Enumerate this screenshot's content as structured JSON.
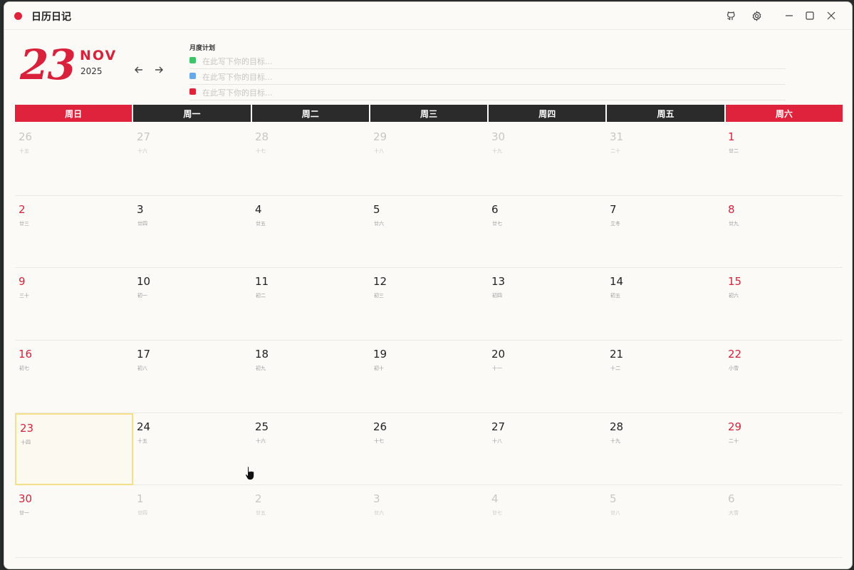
{
  "app": {
    "title": "日历日记"
  },
  "header": {
    "day": "23",
    "month": "NOV",
    "year": "2025",
    "plan_label": "月度计划",
    "goals": [
      {
        "color": "#3fc46a",
        "placeholder": "在此写下你的目标..."
      },
      {
        "color": "#6aa9e9",
        "placeholder": "在此写下你的目标..."
      },
      {
        "color": "#e0233c",
        "placeholder": "在此写下你的目标..."
      }
    ]
  },
  "weekdays": [
    "周日",
    "周一",
    "周二",
    "周三",
    "周四",
    "周五",
    "周六"
  ],
  "weeks": [
    [
      {
        "day": "26",
        "lunar": "十五",
        "other": true
      },
      {
        "day": "27",
        "lunar": "十六",
        "other": true
      },
      {
        "day": "28",
        "lunar": "十七",
        "other": true
      },
      {
        "day": "29",
        "lunar": "十八",
        "other": true
      },
      {
        "day": "30",
        "lunar": "十九",
        "other": true
      },
      {
        "day": "31",
        "lunar": "二十",
        "other": true
      },
      {
        "day": "1",
        "lunar": "廿二",
        "other": false
      }
    ],
    [
      {
        "day": "2",
        "lunar": "廿三"
      },
      {
        "day": "3",
        "lunar": "廿四"
      },
      {
        "day": "4",
        "lunar": "廿五"
      },
      {
        "day": "5",
        "lunar": "廿六"
      },
      {
        "day": "6",
        "lunar": "廿七"
      },
      {
        "day": "7",
        "lunar": "立冬"
      },
      {
        "day": "8",
        "lunar": "廿九"
      }
    ],
    [
      {
        "day": "9",
        "lunar": "三十"
      },
      {
        "day": "10",
        "lunar": "初一"
      },
      {
        "day": "11",
        "lunar": "初二"
      },
      {
        "day": "12",
        "lunar": "初三"
      },
      {
        "day": "13",
        "lunar": "初四"
      },
      {
        "day": "14",
        "lunar": "初五"
      },
      {
        "day": "15",
        "lunar": "初六"
      }
    ],
    [
      {
        "day": "16",
        "lunar": "初七"
      },
      {
        "day": "17",
        "lunar": "初八"
      },
      {
        "day": "18",
        "lunar": "初九"
      },
      {
        "day": "19",
        "lunar": "初十"
      },
      {
        "day": "20",
        "lunar": "十一"
      },
      {
        "day": "21",
        "lunar": "十二"
      },
      {
        "day": "22",
        "lunar": "小雪"
      }
    ],
    [
      {
        "day": "23",
        "lunar": "十四",
        "today": true
      },
      {
        "day": "24",
        "lunar": "十五"
      },
      {
        "day": "25",
        "lunar": "十六"
      },
      {
        "day": "26",
        "lunar": "十七"
      },
      {
        "day": "27",
        "lunar": "十八"
      },
      {
        "day": "28",
        "lunar": "十九"
      },
      {
        "day": "29",
        "lunar": "二十"
      }
    ],
    [
      {
        "day": "30",
        "lunar": "廿一"
      },
      {
        "day": "1",
        "lunar": "廿四",
        "other": true
      },
      {
        "day": "2",
        "lunar": "廿五",
        "other": true
      },
      {
        "day": "3",
        "lunar": "廿六",
        "other": true
      },
      {
        "day": "4",
        "lunar": "廿七",
        "other": true
      },
      {
        "day": "5",
        "lunar": "廿八",
        "other": true
      },
      {
        "day": "6",
        "lunar": "大雪",
        "other": true
      }
    ]
  ],
  "colors": {
    "accent": "#e0233c",
    "header_dark": "#2b2b2b",
    "today_border": "#f7df8a"
  },
  "icons": {
    "github": "github-icon",
    "settings": "gear-icon",
    "minimize": "minimize-icon",
    "maximize": "maximize-icon",
    "close": "close-icon"
  }
}
